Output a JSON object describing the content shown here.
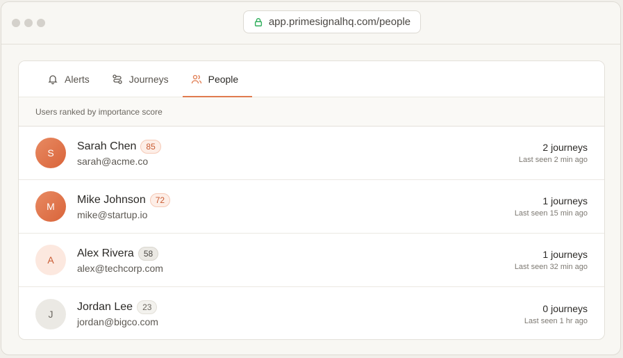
{
  "browser": {
    "url": "app.primesignalhq.com/people"
  },
  "tabs": [
    {
      "label": "Alerts",
      "icon": "bell-icon",
      "active": false
    },
    {
      "label": "Journeys",
      "icon": "route-icon",
      "active": false
    },
    {
      "label": "People",
      "icon": "users-icon",
      "active": true
    }
  ],
  "subheader": "Users ranked by importance score",
  "colors": {
    "accent": "#e07b4f"
  },
  "people": [
    {
      "initial": "S",
      "name": "Sarah Chen",
      "score": "85",
      "email": "sarah@acme.co",
      "journeys": "2 journeys",
      "last_seen": "Last seen 2 min ago"
    },
    {
      "initial": "M",
      "name": "Mike Johnson",
      "score": "72",
      "email": "mike@startup.io",
      "journeys": "1 journeys",
      "last_seen": "Last seen 15 min ago"
    },
    {
      "initial": "A",
      "name": "Alex Rivera",
      "score": "58",
      "email": "alex@techcorp.com",
      "journeys": "1 journeys",
      "last_seen": "Last seen 32 min ago"
    },
    {
      "initial": "J",
      "name": "Jordan Lee",
      "score": "23",
      "email": "jordan@bigco.com",
      "journeys": "0 journeys",
      "last_seen": "Last seen 1 hr ago"
    }
  ]
}
